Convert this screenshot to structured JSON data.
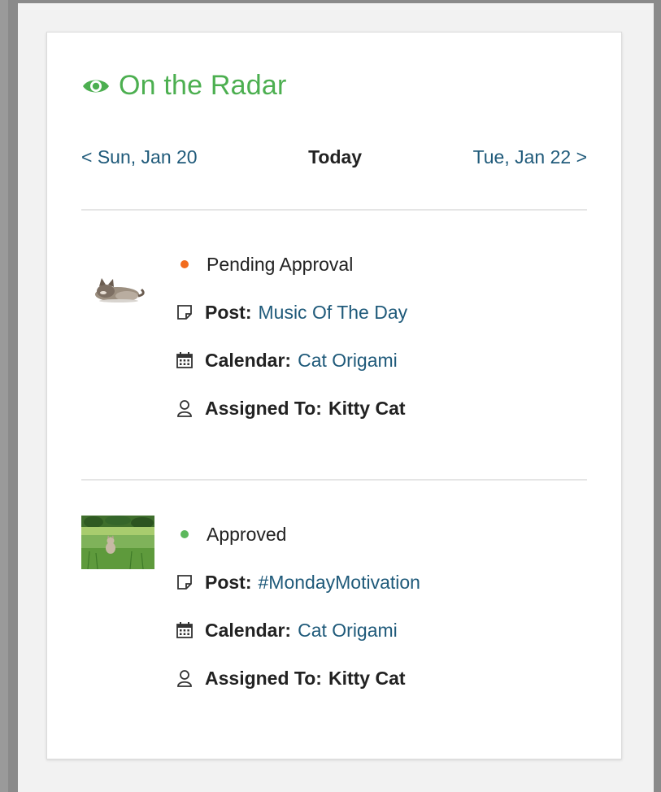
{
  "widget": {
    "title": "On the Radar",
    "title_icon": "eye-icon",
    "accent_color": "#4caf50",
    "link_color": "#1f5a7a"
  },
  "date_nav": {
    "prev_label": "< Sun, Jan 20",
    "current_label": "Today",
    "next_label": "Tue, Jan 22 >"
  },
  "items": [
    {
      "status": "Pending Approval",
      "status_color": "#f26b1d",
      "thumbnail": "cat-lying-thumbnail",
      "post_label": "Post:",
      "post_title": "Music Of The Day",
      "calendar_label": "Calendar:",
      "calendar_name": "Cat Origami",
      "assigned_label": "Assigned To:",
      "assigned_to": "Kitty Cat"
    },
    {
      "status": "Approved",
      "status_color": "#5cb85c",
      "thumbnail": "cat-in-grass-thumbnail",
      "post_label": "Post:",
      "post_title": "#MondayMotivation",
      "calendar_label": "Calendar:",
      "calendar_name": "Cat Origami",
      "assigned_label": "Assigned To:",
      "assigned_to": "Kitty Cat"
    }
  ]
}
